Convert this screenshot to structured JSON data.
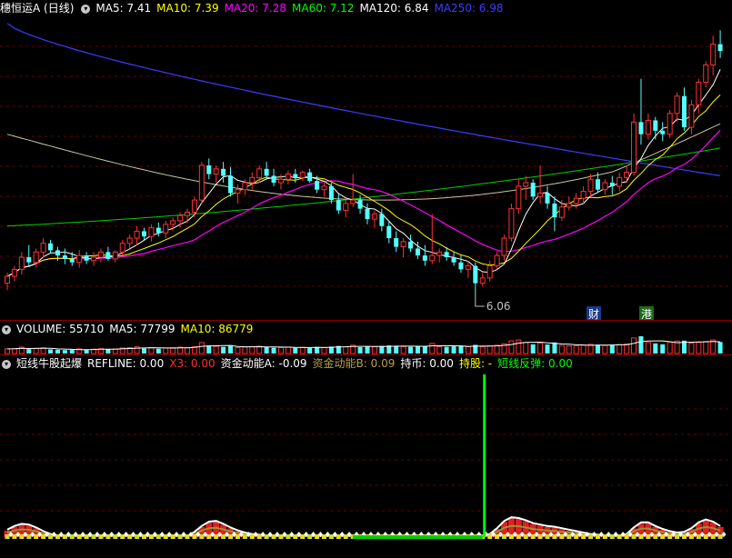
{
  "main_header": {
    "stock_name": "穗恒运A (日线)",
    "ma_labels": [
      {
        "text": "MA5: 7.41",
        "color": "#ffffff"
      },
      {
        "text": "MA10: 7.39",
        "color": "#ffff00"
      },
      {
        "text": "MA20: 7.28",
        "color": "#ff00ff"
      },
      {
        "text": "MA60: 7.12",
        "color": "#00ff00"
      },
      {
        "text": "MA120: 6.84",
        "color": "#ffffff"
      },
      {
        "text": "MA250: 6.98",
        "color": "#3c3cff"
      }
    ]
  },
  "volume_header": {
    "labels": [
      {
        "text": "VOLUME: 55710",
        "color": "#ffffff"
      },
      {
        "text": "MA5: 77799",
        "color": "#ffffff"
      },
      {
        "text": "MA10: 86779",
        "color": "#ffff00"
      }
    ]
  },
  "indicator_header": {
    "labels": [
      {
        "text": "短线牛股起爆",
        "color": "#ffffff"
      },
      {
        "text": "REFLINE: 0.00",
        "color": "#ffffff"
      },
      {
        "text": "X3: 0.00",
        "color": "#ff3030"
      },
      {
        "text": "资金动能A: -0.09",
        "color": "#ffffff"
      },
      {
        "text": "资金动能B: 0.09",
        "color": "#b8a040"
      },
      {
        "text": "持币: 0.00",
        "color": "#ffffff"
      },
      {
        "text": "持股: -",
        "color": "#ffff00"
      },
      {
        "text": "短线反弹: 0.00",
        "color": "#00ff00"
      }
    ]
  },
  "annotations": {
    "low_label": "6.06",
    "tag_cai": "财",
    "tag_gang": "港"
  },
  "chart_data": {
    "type": "candlestick",
    "ylim": [
      5.95,
      7.65
    ],
    "grid": true,
    "candles_ohlc": [
      [
        6.12,
        6.18,
        6.08,
        6.16
      ],
      [
        6.16,
        6.22,
        6.13,
        6.2
      ],
      [
        6.2,
        6.3,
        6.17,
        6.27
      ],
      [
        6.27,
        6.34,
        6.22,
        6.24
      ],
      [
        6.24,
        6.32,
        6.21,
        6.3
      ],
      [
        6.3,
        6.38,
        6.27,
        6.35
      ],
      [
        6.35,
        6.37,
        6.29,
        6.31
      ],
      [
        6.31,
        6.33,
        6.25,
        6.28
      ],
      [
        6.28,
        6.32,
        6.23,
        6.26
      ],
      [
        6.26,
        6.3,
        6.22,
        6.24
      ],
      [
        6.24,
        6.31,
        6.21,
        6.28
      ],
      [
        6.28,
        6.3,
        6.23,
        6.25
      ],
      [
        6.25,
        6.3,
        6.22,
        6.27
      ],
      [
        6.27,
        6.32,
        6.24,
        6.3
      ],
      [
        6.3,
        6.33,
        6.25,
        6.26
      ],
      [
        6.26,
        6.31,
        6.24,
        6.3
      ],
      [
        6.3,
        6.37,
        6.28,
        6.35
      ],
      [
        6.35,
        6.4,
        6.32,
        6.38
      ],
      [
        6.38,
        6.45,
        6.34,
        6.42
      ],
      [
        6.42,
        6.44,
        6.37,
        6.39
      ],
      [
        6.39,
        6.46,
        6.36,
        6.44
      ],
      [
        6.44,
        6.47,
        6.39,
        6.41
      ],
      [
        6.41,
        6.48,
        6.38,
        6.46
      ],
      [
        6.46,
        6.5,
        6.42,
        6.48
      ],
      [
        6.48,
        6.53,
        6.44,
        6.51
      ],
      [
        6.51,
        6.55,
        6.47,
        6.53
      ],
      [
        6.53,
        6.62,
        6.5,
        6.6
      ],
      [
        6.6,
        6.82,
        6.58,
        6.8
      ],
      [
        6.8,
        6.84,
        6.72,
        6.75
      ],
      [
        6.75,
        6.8,
        6.7,
        6.78
      ],
      [
        6.78,
        6.82,
        6.7,
        6.74
      ],
      [
        6.74,
        6.79,
        6.62,
        6.64
      ],
      [
        6.64,
        6.69,
        6.58,
        6.66
      ],
      [
        6.66,
        6.72,
        6.63,
        6.7
      ],
      [
        6.7,
        6.76,
        6.66,
        6.73
      ],
      [
        6.73,
        6.8,
        6.7,
        6.78
      ],
      [
        6.78,
        6.82,
        6.72,
        6.74
      ],
      [
        6.74,
        6.78,
        6.68,
        6.7
      ],
      [
        6.7,
        6.75,
        6.66,
        6.72
      ],
      [
        6.72,
        6.77,
        6.69,
        6.75
      ],
      [
        6.75,
        6.78,
        6.7,
        6.73
      ],
      [
        6.73,
        6.77,
        6.71,
        6.76
      ],
      [
        6.76,
        6.78,
        6.7,
        6.71
      ],
      [
        6.71,
        6.74,
        6.64,
        6.66
      ],
      [
        6.66,
        6.7,
        6.62,
        6.68
      ],
      [
        6.68,
        6.7,
        6.58,
        6.6
      ],
      [
        6.6,
        6.64,
        6.52,
        6.54
      ],
      [
        6.54,
        6.6,
        6.5,
        6.58
      ],
      [
        6.58,
        6.75,
        6.56,
        6.6
      ],
      [
        6.6,
        6.63,
        6.52,
        6.55
      ],
      [
        6.55,
        6.58,
        6.46,
        6.49
      ],
      [
        6.49,
        6.54,
        6.44,
        6.52
      ],
      [
        6.52,
        6.55,
        6.42,
        6.45
      ],
      [
        6.45,
        6.48,
        6.35,
        6.38
      ],
      [
        6.38,
        6.42,
        6.3,
        6.33
      ],
      [
        6.33,
        6.38,
        6.27,
        6.36
      ],
      [
        6.36,
        6.4,
        6.3,
        6.32
      ],
      [
        6.32,
        6.36,
        6.26,
        6.28
      ],
      [
        6.28,
        6.34,
        6.22,
        6.25
      ],
      [
        6.25,
        6.52,
        6.23,
        6.28
      ],
      [
        6.28,
        6.32,
        6.24,
        6.3
      ],
      [
        6.3,
        6.33,
        6.25,
        6.27
      ],
      [
        6.27,
        6.3,
        6.22,
        6.24
      ],
      [
        6.24,
        6.28,
        6.18,
        6.2
      ],
      [
        6.2,
        6.25,
        6.15,
        6.22
      ],
      [
        6.22,
        6.24,
        6.06,
        6.12
      ],
      [
        6.12,
        6.18,
        6.1,
        6.15
      ],
      [
        6.15,
        6.25,
        6.13,
        6.22
      ],
      [
        6.22,
        6.3,
        6.2,
        6.28
      ],
      [
        6.28,
        6.4,
        6.25,
        6.38
      ],
      [
        6.38,
        6.58,
        6.36,
        6.55
      ],
      [
        6.55,
        6.72,
        6.52,
        6.68
      ],
      [
        6.68,
        6.74,
        6.6,
        6.7
      ],
      [
        6.7,
        6.72,
        6.6,
        6.62
      ],
      [
        6.62,
        6.8,
        6.58,
        6.64
      ],
      [
        6.64,
        6.68,
        6.55,
        6.58
      ],
      [
        6.58,
        6.62,
        6.42,
        6.5
      ],
      [
        6.5,
        6.6,
        6.48,
        6.56
      ],
      [
        6.56,
        6.62,
        6.54,
        6.58
      ],
      [
        6.58,
        6.64,
        6.55,
        6.61
      ],
      [
        6.61,
        6.68,
        6.58,
        6.65
      ],
      [
        6.65,
        6.75,
        6.62,
        6.72
      ],
      [
        6.72,
        6.76,
        6.64,
        6.66
      ],
      [
        6.66,
        6.72,
        6.63,
        6.7
      ],
      [
        6.7,
        6.74,
        6.63,
        6.68
      ],
      [
        6.68,
        6.76,
        6.65,
        6.73
      ],
      [
        6.73,
        6.8,
        6.7,
        6.76
      ],
      [
        6.76,
        7.1,
        6.74,
        7.05
      ],
      [
        7.05,
        7.3,
        6.92,
        6.98
      ],
      [
        6.98,
        7.1,
        6.95,
        7.06
      ],
      [
        7.06,
        7.08,
        6.95,
        7.0
      ],
      [
        7.0,
        7.05,
        6.94,
        6.98
      ],
      [
        6.98,
        7.12,
        6.96,
        7.1
      ],
      [
        7.1,
        7.22,
        7.05,
        7.2
      ],
      [
        7.2,
        7.25,
        7.0,
        7.02
      ],
      [
        7.02,
        7.18,
        6.98,
        7.15
      ],
      [
        7.15,
        7.3,
        7.1,
        7.28
      ],
      [
        7.28,
        7.4,
        7.25,
        7.38
      ],
      [
        7.38,
        7.55,
        7.32,
        7.5
      ],
      [
        7.5,
        7.58,
        7.42,
        7.46
      ]
    ],
    "volume": [
      40,
      42,
      55,
      38,
      45,
      50,
      36,
      33,
      30,
      32,
      40,
      35,
      38,
      42,
      36,
      40,
      48,
      52,
      58,
      44,
      50,
      42,
      48,
      52,
      55,
      50,
      60,
      95,
      70,
      62,
      58,
      66,
      52,
      56,
      60,
      64,
      55,
      50,
      52,
      56,
      50,
      54,
      48,
      58,
      52,
      60,
      66,
      58,
      72,
      55,
      62,
      58,
      64,
      70,
      66,
      60,
      58,
      62,
      66,
      88,
      60,
      58,
      62,
      65,
      60,
      75,
      58,
      66,
      72,
      85,
      110,
      118,
      95,
      80,
      92,
      78,
      96,
      70,
      66,
      68,
      72,
      80,
      76,
      70,
      74,
      78,
      82,
      135,
      150,
      95,
      88,
      80,
      100,
      108,
      112,
      90,
      96,
      105,
      118,
      100
    ],
    "indicator_main": [
      0.9,
      1.4,
      1.7,
      1.6,
      1.2,
      0.7,
      0.3,
      0.1,
      0,
      0,
      0,
      0,
      0,
      0,
      0,
      0,
      0,
      0,
      0,
      0,
      0,
      0,
      0,
      0,
      0,
      0,
      0.6,
      1.4,
      2.0,
      2.1,
      1.7,
      1.2,
      0.8,
      0.5,
      0.3,
      0.2,
      0.1,
      0,
      0,
      0,
      0,
      0,
      0,
      0,
      0,
      0,
      0,
      0,
      0,
      0,
      0,
      0,
      0,
      0,
      0,
      0,
      0,
      0,
      0,
      0,
      0,
      0,
      0,
      0,
      0,
      0,
      0,
      0.3,
      1.1,
      2.1,
      2.6,
      2.5,
      2.2,
      1.8,
      1.6,
      1.4,
      1.3,
      1.1,
      0.9,
      0.7,
      0.5,
      0.3,
      0.2,
      0.1,
      0,
      0,
      0.3,
      1.2,
      1.9,
      1.9,
      1.4,
      1.0,
      0.7,
      0.5,
      0.6,
      1.1,
      1.9,
      2.3,
      2.0,
      1.4
    ],
    "signal_bar_index": 66
  }
}
